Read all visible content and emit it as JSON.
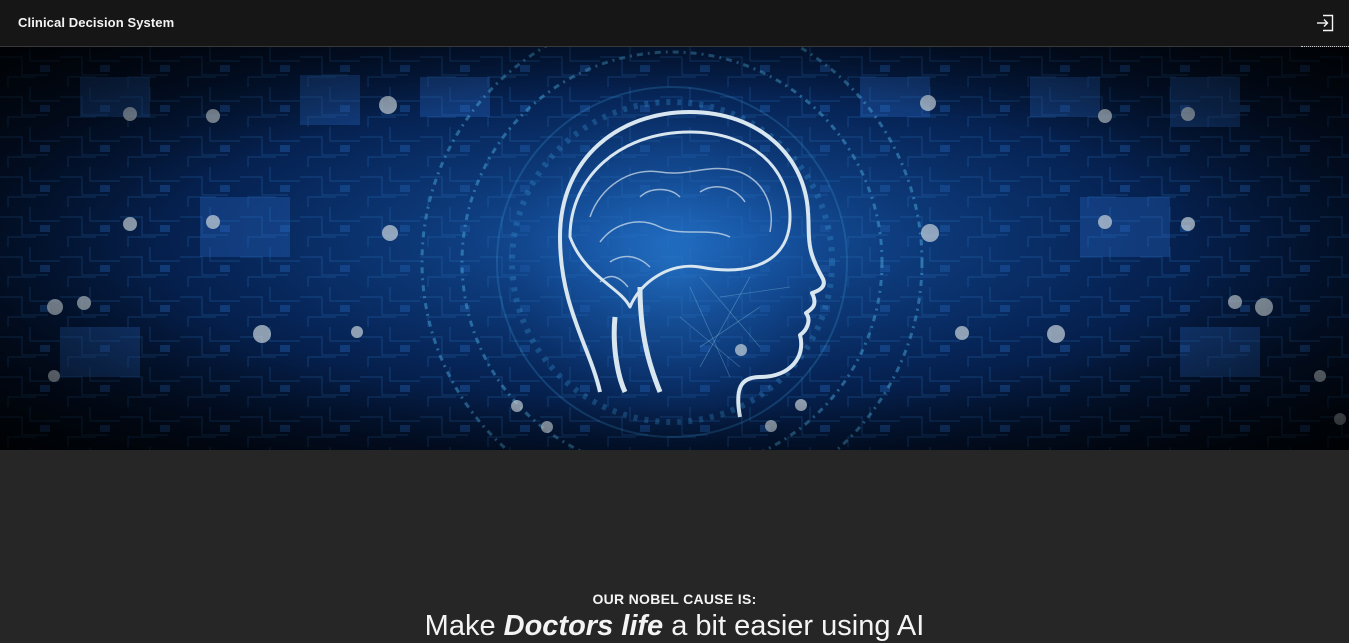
{
  "header": {
    "title": "Clinical Decision System",
    "login_icon": "login-icon"
  },
  "hero": {
    "image_subject": "ai-brain-circuit-illustration"
  },
  "mission": {
    "kicker": "OUR NOBEL CAUSE IS:",
    "headline_before": "Make ",
    "headline_emphasis": "Doctors life",
    "headline_after": " a bit easier using AI"
  },
  "colors": {
    "header_bg": "#161616",
    "page_bg": "#262626",
    "text": "#f4f4f4",
    "hero_blue": "#1a5db0"
  }
}
